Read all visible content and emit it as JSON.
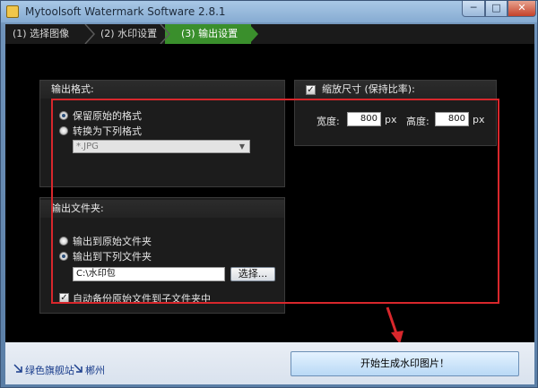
{
  "window": {
    "title": "Mytoolsoft Watermark Software 2.8.1",
    "controls": {
      "minimize": "─",
      "maximize": "□",
      "close": "✕"
    }
  },
  "steps": [
    {
      "label": "(1) 选择图像"
    },
    {
      "label": "(2) 水印设置"
    },
    {
      "label": "(3) 输出设置"
    }
  ],
  "output_format": {
    "header": "输出格式:",
    "keep_original": "保留原始的格式",
    "convert_to": "转换为下列格式",
    "format_value": "*.JPG",
    "dropdown_arrow": "▼"
  },
  "output_folder": {
    "header": "输出文件夹:",
    "to_original": "输出到原始文件夹",
    "to_following": "输出到下列文件夹",
    "path_value": "C:\\水印包",
    "browse_label": "选择...",
    "auto_backup": "自动备份原始文件到子文件夹中"
  },
  "resize": {
    "header": "缩放尺寸 (保持比率):",
    "width_label": "宽度:",
    "width_value": "800",
    "width_unit": "px",
    "height_label": "高度:",
    "height_value": "800",
    "height_unit": "px",
    "check_mark": "✓"
  },
  "footer": {
    "link1": "绿色旗舰站",
    "link2": "郴州",
    "start_button": "开始生成水印图片！"
  },
  "colors": {
    "annotation_red": "#d8272c",
    "active_step_green": "#3a8f2c"
  }
}
